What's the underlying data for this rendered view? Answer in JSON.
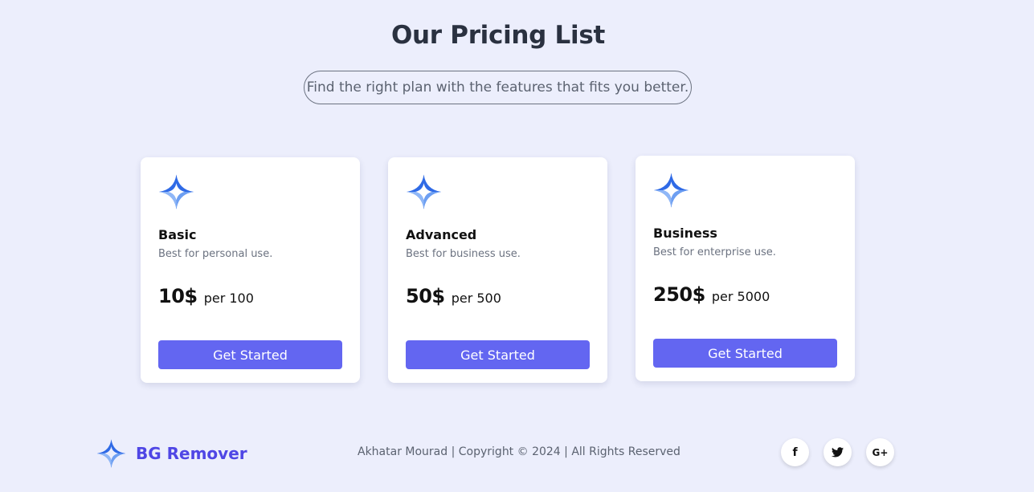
{
  "header": {
    "title": "Our Pricing List",
    "subtitle": "Find the right plan with the features that fits you better."
  },
  "plans": [
    {
      "name": "Basic",
      "description": "Best for personal use.",
      "price": "10$",
      "per": "per 100",
      "button_label": "Get Started",
      "icon": "sparkle-logo-icon"
    },
    {
      "name": "Advanced",
      "description": "Best for business use.",
      "price": "50$",
      "per": "per 500",
      "button_label": "Get Started",
      "icon": "sparkle-logo-icon"
    },
    {
      "name": "Business",
      "description": "Best for enterprise use.",
      "price": "250$",
      "per": "per 5000",
      "button_label": "Get Started",
      "icon": "sparkle-logo-icon"
    }
  ],
  "footer": {
    "brand": "BG Remover",
    "brand_icon": "sparkle-logo-icon",
    "copyright": "Akhatar Mourad | Copyright © 2024 | All Rights Reserved",
    "social": [
      {
        "name": "facebook",
        "glyph": "f",
        "icon": "facebook-icon"
      },
      {
        "name": "twitter",
        "glyph": "🐦",
        "icon": "twitter-icon"
      },
      {
        "name": "google-plus",
        "glyph": "G+",
        "icon": "google-plus-icon"
      }
    ]
  },
  "colors": {
    "background": "#eceefc",
    "accent": "#6366f1",
    "brand_text": "#4f46e5",
    "logo_dark": "#2f6ae6",
    "logo_light": "#8fb7f7"
  }
}
